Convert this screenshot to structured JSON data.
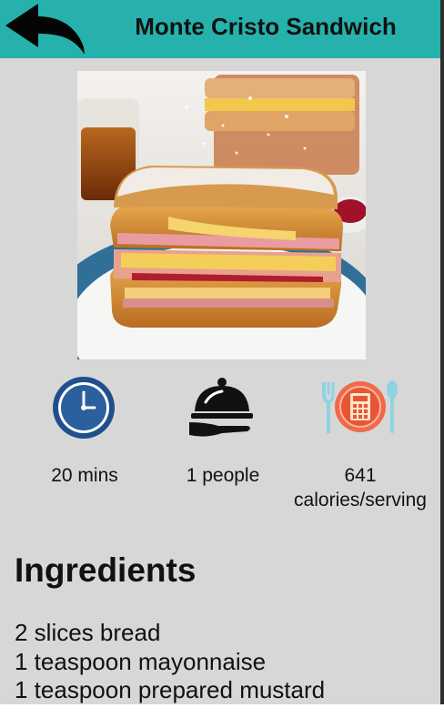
{
  "header": {
    "title": "Monte Cristo Sandwich",
    "back_icon": "back-arrow-icon",
    "background": "#26b1ad"
  },
  "recipe": {
    "photo": "monte-cristo-sandwich-photo"
  },
  "stats": {
    "time": {
      "icon": "clock-icon",
      "label": "20 mins"
    },
    "servings": {
      "icon": "serving-cloche-icon",
      "label": "1 people"
    },
    "calories": {
      "icon": "calorie-calculator-icon",
      "value": "641",
      "unit": "calories/serving"
    }
  },
  "ingredients": {
    "title": "Ingredients",
    "items": [
      "2 slices bread",
      "1 teaspoon mayonnaise",
      "1 teaspoon prepared mustard"
    ]
  }
}
